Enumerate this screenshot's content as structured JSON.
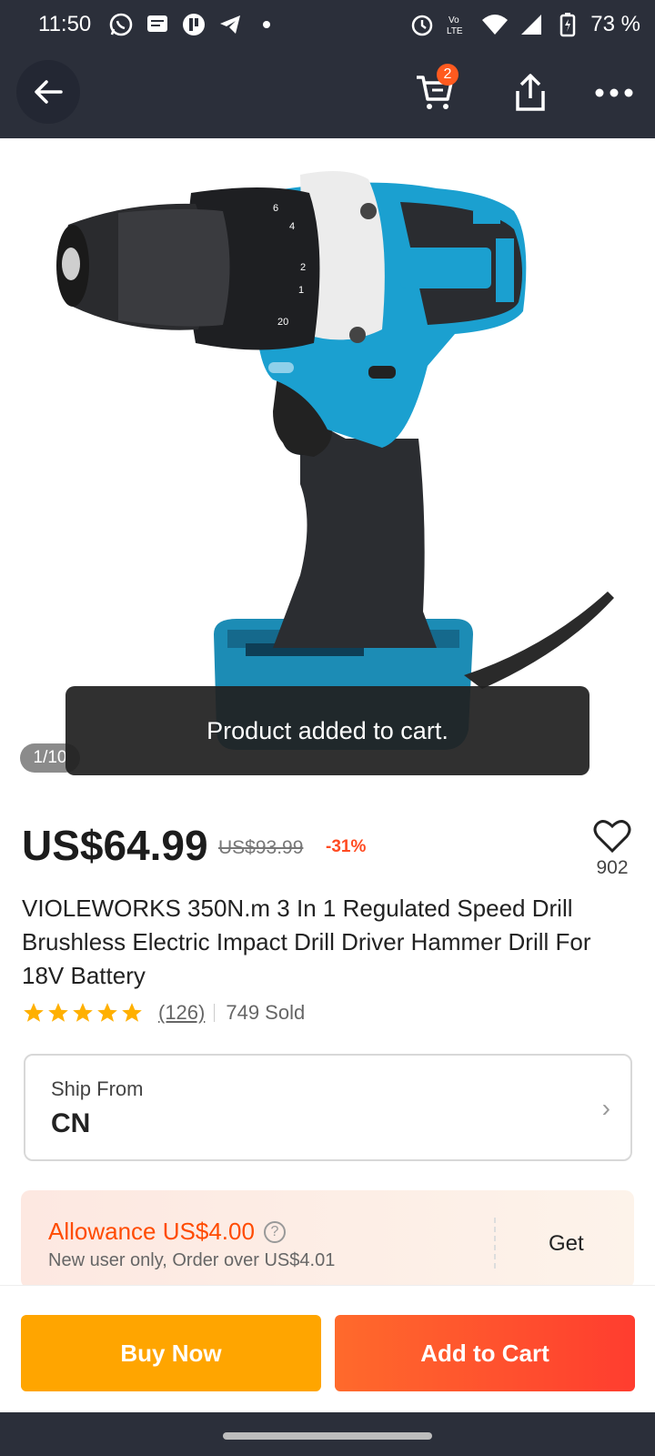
{
  "status_bar": {
    "time": "11:50",
    "battery": "73 %"
  },
  "header": {
    "cart_count": "2"
  },
  "gallery": {
    "counter": "1/10",
    "toast": "Product added to cart."
  },
  "product": {
    "price": "US$64.99",
    "old_price": "US$93.99",
    "discount": "-31%",
    "wishlist_count": "902",
    "title": "VIOLEWORKS 350N.m 3 In 1 Regulated Speed Drill Brushless Electric Impact Drill Driver Hammer Drill For 18V Battery",
    "reviews": "(126)",
    "sold": "749 Sold",
    "star_rating": 5
  },
  "shipping": {
    "label": "Ship From",
    "value": "CN"
  },
  "allowance": {
    "title": "Allowance US$4.00",
    "subtitle": "New user only, Order over US$4.01",
    "action": "Get"
  },
  "actions": {
    "buy_now": "Buy Now",
    "add_to_cart": "Add to Cart"
  },
  "colors": {
    "accent": "#ff4b00",
    "buy": "#ffa500",
    "cart": "#ff3d2f",
    "star": "#ffb000"
  }
}
